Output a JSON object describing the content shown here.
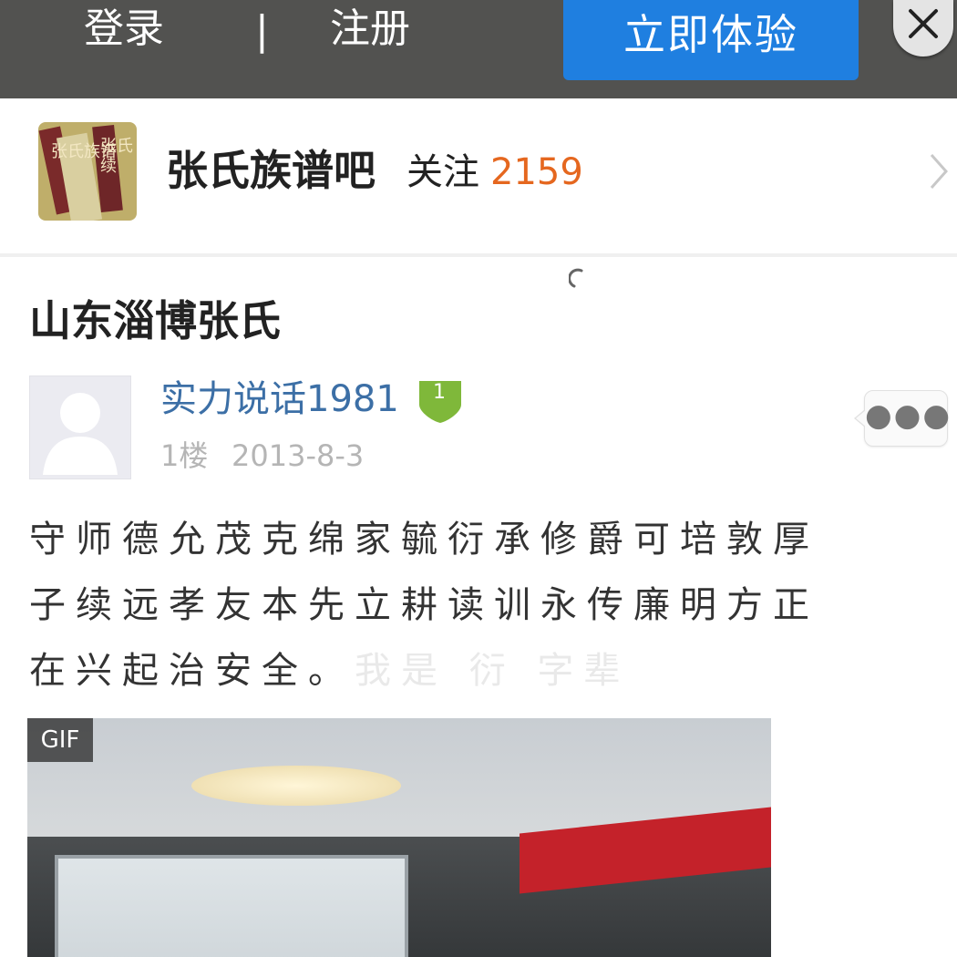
{
  "topbar": {
    "login_label": "登录",
    "separator": "|",
    "register_label": "注册",
    "try_button_label": "立即体验",
    "close_icon": "close-icon",
    "background": "#525250",
    "accent": "#1f7fe0"
  },
  "forum": {
    "name": "张氏族谱吧",
    "follow_label": "关注",
    "follow_count": "2159",
    "logo_icon": "forum-logo",
    "logo_text": [
      "张氏族谱",
      "张氏续"
    ],
    "count_color": "#e5671f"
  },
  "post": {
    "title": "山东淄博张氏",
    "username": "实力说话1981",
    "level": "1",
    "floor": "1楼",
    "date": "2013-8-3",
    "body_lines": [
      "守师德允茂克绵家毓衍承修爵可培敦厚",
      "子续远孝友本先立耕读训永传廉明方正",
      "在兴起治安全。"
    ],
    "body_faded": "我是 衍 字辈",
    "media_badge": "GIF",
    "username_color": "#3c6fa6"
  }
}
